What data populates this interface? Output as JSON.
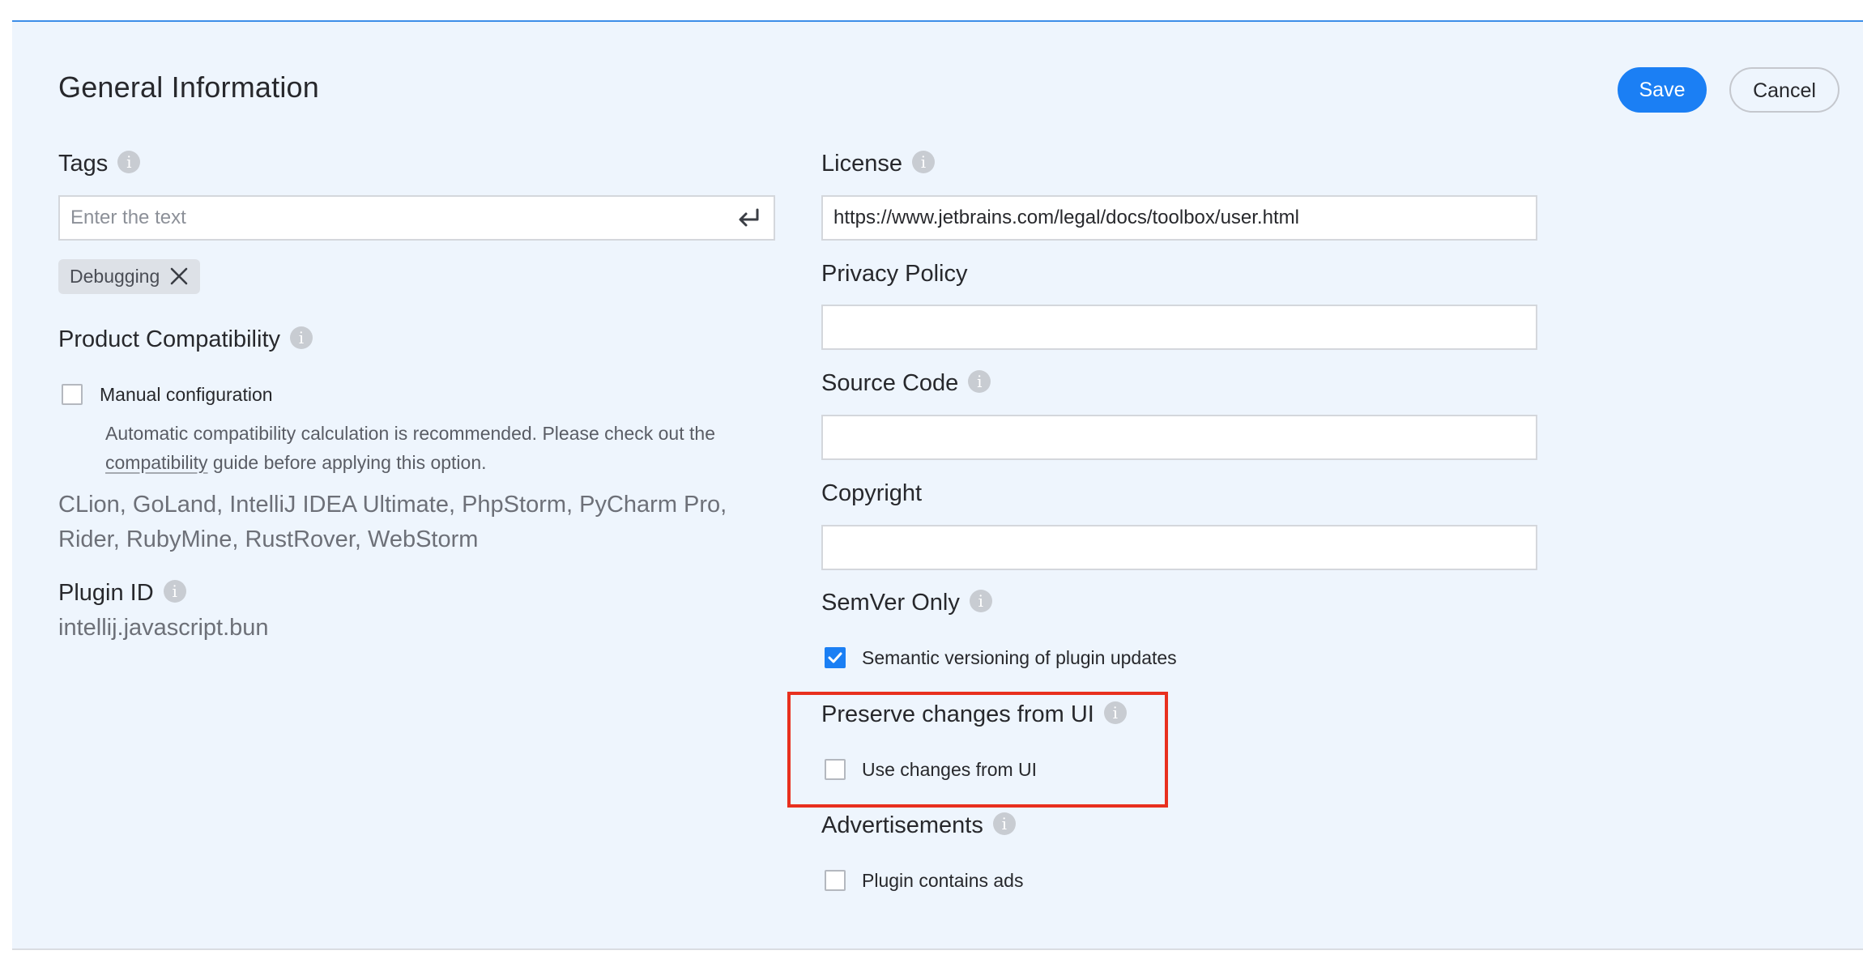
{
  "header": {
    "title": "General Information",
    "save_label": "Save",
    "cancel_label": "Cancel"
  },
  "tags": {
    "label": "Tags",
    "placeholder": "Enter the text",
    "chips": [
      "Debugging"
    ]
  },
  "compatibility": {
    "label": "Product Compatibility",
    "manual_config_label": "Manual configuration",
    "manual_config_checked": false,
    "hint_before": "Automatic compatibility calculation is recommended. Please check out the ",
    "hint_link": "compatibility",
    "hint_after": " guide before applying this option.",
    "products": "CLion, GoLand, IntelliJ IDEA Ultimate, PhpStorm, PyCharm Pro, Rider, RubyMine, RustRover, WebStorm"
  },
  "plugin_id": {
    "label": "Plugin ID",
    "value": "intellij.javascript.bun"
  },
  "license": {
    "label": "License",
    "value": "https://www.jetbrains.com/legal/docs/toolbox/user.html"
  },
  "privacy_policy": {
    "label": "Privacy Policy",
    "value": ""
  },
  "source_code": {
    "label": "Source Code",
    "value": ""
  },
  "copyright": {
    "label": "Copyright",
    "value": ""
  },
  "semver": {
    "label": "SemVer Only",
    "checkbox_label": "Semantic versioning of plugin updates",
    "checked": true
  },
  "preserve": {
    "label": "Preserve changes from UI",
    "checkbox_label": "Use changes from UI",
    "checked": false
  },
  "ads": {
    "label": "Advertisements",
    "checkbox_label": "Plugin contains ads",
    "checked": false
  },
  "colors": {
    "accent": "#1b7ff4",
    "panel_bg": "#eef5fd",
    "highlight": "#e8301e"
  },
  "icons": {
    "info": "info-icon",
    "enter": "enter-icon",
    "remove": "close-icon",
    "check": "checkmark-icon"
  }
}
